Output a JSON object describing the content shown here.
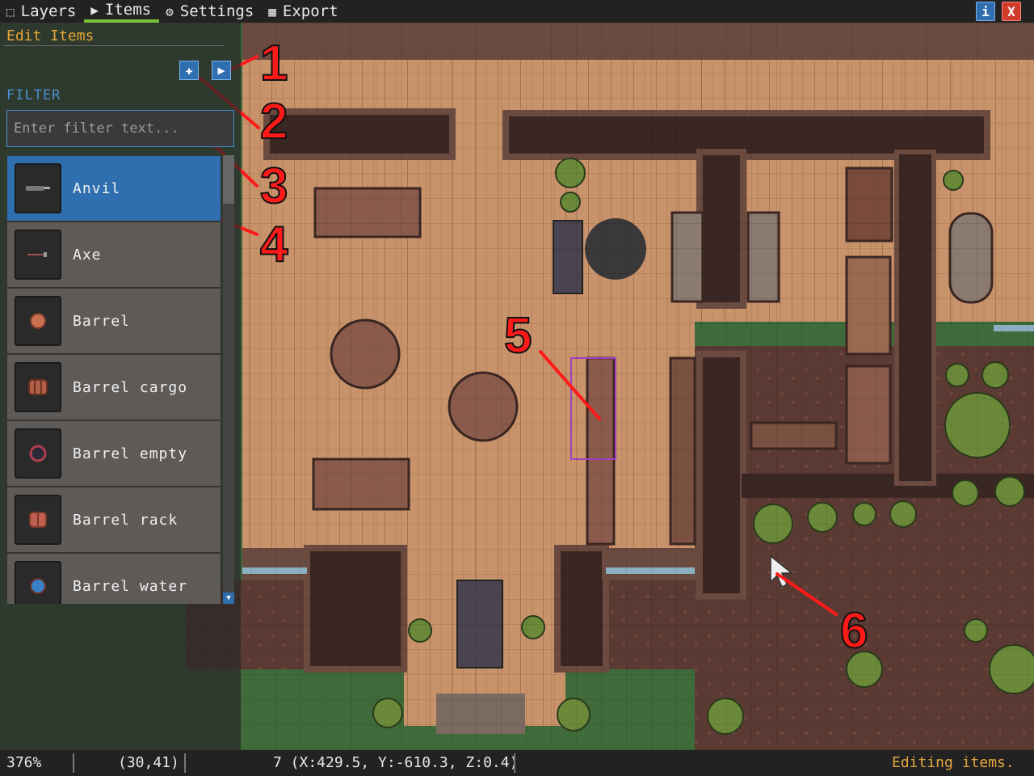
{
  "menubar": {
    "tabs": [
      {
        "label": "Layers",
        "icon": "layers-icon"
      },
      {
        "label": "Items",
        "icon": "cursor-icon"
      },
      {
        "label": "Settings",
        "icon": "gear-icon"
      },
      {
        "label": "Export",
        "icon": "grid-icon"
      }
    ],
    "active_tab": "Items",
    "info_label": "i",
    "close_label": "X"
  },
  "panel": {
    "title": "Edit Items",
    "filter_label": "FILTER",
    "filter_placeholder": "Enter filter text...",
    "filter_value": "",
    "items": [
      {
        "label": "Anvil",
        "icon": "anvil-icon",
        "selected": true
      },
      {
        "label": "Axe",
        "icon": "axe-icon"
      },
      {
        "label": "Barrel",
        "icon": "barrel-icon"
      },
      {
        "label": "Barrel cargo",
        "icon": "barrel-cargo-icon"
      },
      {
        "label": "Barrel empty",
        "icon": "barrel-empty-icon"
      },
      {
        "label": "Barrel rack",
        "icon": "barrel-rack-icon"
      },
      {
        "label": "Barrel water",
        "icon": "barrel-water-icon"
      }
    ]
  },
  "statusbar": {
    "zoom": "376%",
    "cell": "(30,41)",
    "cursor": "7 (X:429.5, Y:-610.3, Z:0.4)",
    "message": "Editing items."
  },
  "annotations": [
    "1",
    "2",
    "3",
    "4",
    "5",
    "6"
  ],
  "colors": {
    "accent": "#2f6fb0",
    "title": "#e5a53a",
    "active_tab": "#7ac13a",
    "annotation": "#ff1a1a",
    "floor": "#c8936a",
    "grass": "#3f6a3a"
  }
}
